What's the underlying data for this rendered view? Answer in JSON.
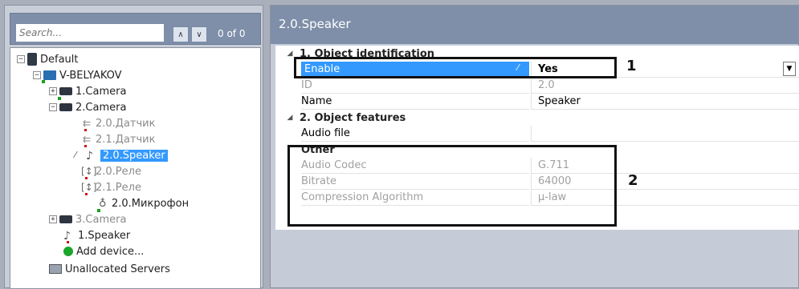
{
  "search": {
    "placeholder": "Search...",
    "up": "∧",
    "down": "∨",
    "count": "0 of 0"
  },
  "tree": {
    "items": [
      {
        "label": "Default",
        "exp": "−",
        "icon": "server-icon"
      },
      {
        "label": "V-BELYAKOV",
        "exp": "−",
        "icon": "computer-icon"
      },
      {
        "label": "1.Camera",
        "exp": "+",
        "icon": "camera-icon"
      },
      {
        "label": "2.Camera",
        "exp": "−",
        "icon": "camera-icon"
      },
      {
        "label": "2.0.Датчик",
        "icon": "sensor-icon",
        "dim": true
      },
      {
        "label": "2.1.Датчик",
        "icon": "sensor-icon",
        "dim": true
      },
      {
        "label": "2.0.Speaker",
        "icon": "speaker-icon",
        "selected": true
      },
      {
        "label": "2.0.Реле",
        "icon": "relay-icon",
        "dim": true
      },
      {
        "label": "2.1.Реле",
        "icon": "relay-icon",
        "dim": true
      },
      {
        "label": "2.0.Микрофон",
        "icon": "microphone-icon"
      },
      {
        "label": "3.Camera",
        "exp": "+",
        "icon": "camera-icon",
        "dim": true
      },
      {
        "label": "1.Speaker",
        "icon": "speaker-icon"
      },
      {
        "label": "Add device...",
        "icon": "add-device-icon"
      },
      {
        "label": "Unallocated Servers",
        "icon": "unallocated-servers-icon"
      }
    ]
  },
  "panel": {
    "title": "2.0.Speaker",
    "cat1": "1. Object identification",
    "enable_label": "Enable",
    "enable_value": "Yes",
    "id_label": "ID",
    "id_value": "2.0",
    "name_label": "Name",
    "name_value": "Speaker",
    "cat2": "2. Object features",
    "audio_file_label": "Audio file",
    "other_label": "Other",
    "codec_label": "Audio Codec",
    "codec_value": "G.711",
    "bitrate_label": "Bitrate",
    "bitrate_value": "64000",
    "compression_label": "Compression Algorithm",
    "compression_value": "μ-law"
  },
  "annotations": {
    "one": "1",
    "two": "2"
  },
  "colors": {
    "header": "#7f8fa9",
    "selection": "#3399ff"
  }
}
